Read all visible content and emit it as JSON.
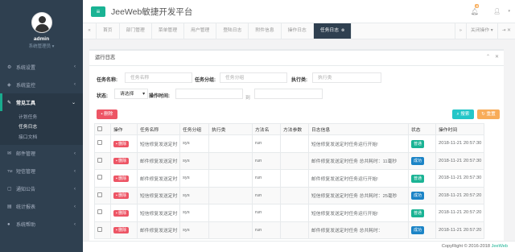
{
  "profile": {
    "username": "admin",
    "role": "系统管理员"
  },
  "sidebar": {
    "items": [
      {
        "label": "系统设置",
        "icon": "gear-icon",
        "glyph": "⚙"
      },
      {
        "label": "系统监控",
        "icon": "monitor-icon",
        "glyph": "◈"
      },
      {
        "label": "常见工具",
        "icon": "wrench-icon",
        "glyph": "✎"
      },
      {
        "label": "邮件管理",
        "icon": "mail-icon",
        "glyph": "✉"
      },
      {
        "label": "短信管理",
        "icon": "sms-icon",
        "glyph": "TM"
      },
      {
        "label": "通知公告",
        "icon": "chat-icon",
        "glyph": "▢"
      },
      {
        "label": "统计报表",
        "icon": "chart-icon",
        "glyph": "▤"
      },
      {
        "label": "系统帮助",
        "icon": "help-icon",
        "glyph": "●"
      }
    ],
    "sub_items": [
      "计划任务",
      "任务日志",
      "接口文档"
    ]
  },
  "header": {
    "brand": "JeeWeb敏捷开发平台",
    "notify_count": "4"
  },
  "tabs": {
    "home": "首页",
    "items": [
      "部门管理",
      "菜单管理",
      "用户管理",
      "登陆日志",
      "附件信息",
      "操作日志",
      "任务日志"
    ],
    "close_ops": "关闭操作",
    "close_glyph": "✕",
    "close_glyph2": "⇥"
  },
  "panel": {
    "title": "运行日志"
  },
  "search": {
    "task_name_label": "任务名称:",
    "task_name_placeholder": "任务名称",
    "task_group_label": "任务分组:",
    "task_group_placeholder": "任务分组",
    "exec_class_label": "执行类:",
    "exec_class_placeholder": "执行类",
    "status_label": "状态:",
    "status_value": "请选择",
    "time_label": "操作时间:",
    "to_label": "到",
    "delete_button": "删除",
    "search_button": "搜索",
    "reset_button": "重置"
  },
  "table": {
    "headers": [
      "操作",
      "任务名称",
      "任务分组",
      "执行类",
      "方法名",
      "方法参数",
      "日志信息",
      "状态",
      "操作时间"
    ],
    "delete_label": "删除",
    "rows": [
      {
        "name": "短信修复发送定时",
        "group": "sys",
        "method": "run",
        "log": "短信修复发送定时任务运行开始!",
        "status": "普通",
        "status_color": "#1ab394",
        "time": "2018-11-21 20:57:30"
      },
      {
        "name": "邮件修复发送定时",
        "group": "sys",
        "method": "run",
        "log": "邮件修复发送定时任务 总共耗时：11毫秒",
        "status": "成功",
        "status_color": "#1c84c6",
        "time": "2018-11-21 20:57:30"
      },
      {
        "name": "邮件修复发送定时",
        "group": "sys",
        "method": "run",
        "log": "邮件修复发送定时任务运行开始!",
        "status": "普通",
        "status_color": "#1ab394",
        "time": "2018-11-21 20:57:30"
      },
      {
        "name": "短信修复发送定时",
        "group": "sys",
        "method": "run",
        "log": "短信修复发送定时任务 总共耗时：25毫秒",
        "status": "成功",
        "status_color": "#1c84c6",
        "time": "2018-11-21 20:57:20"
      },
      {
        "name": "短信修复发送定时",
        "group": "sys",
        "method": "run",
        "log": "短信修复发送定时任务运行开始!",
        "status": "普通",
        "status_color": "#1ab394",
        "time": "2018-11-21 20:57:20"
      },
      {
        "name": "邮件修复发送定时",
        "group": "sys",
        "method": "run",
        "log": "邮件修复发送定时任务 总共耗时：",
        "status": "成功",
        "status_color": "#1c84c6",
        "time": "2018-11-21 20:57:20"
      }
    ]
  },
  "footer": {
    "copyright": "CopyRight © 2016-2018",
    "brand": "JeeWeb"
  }
}
